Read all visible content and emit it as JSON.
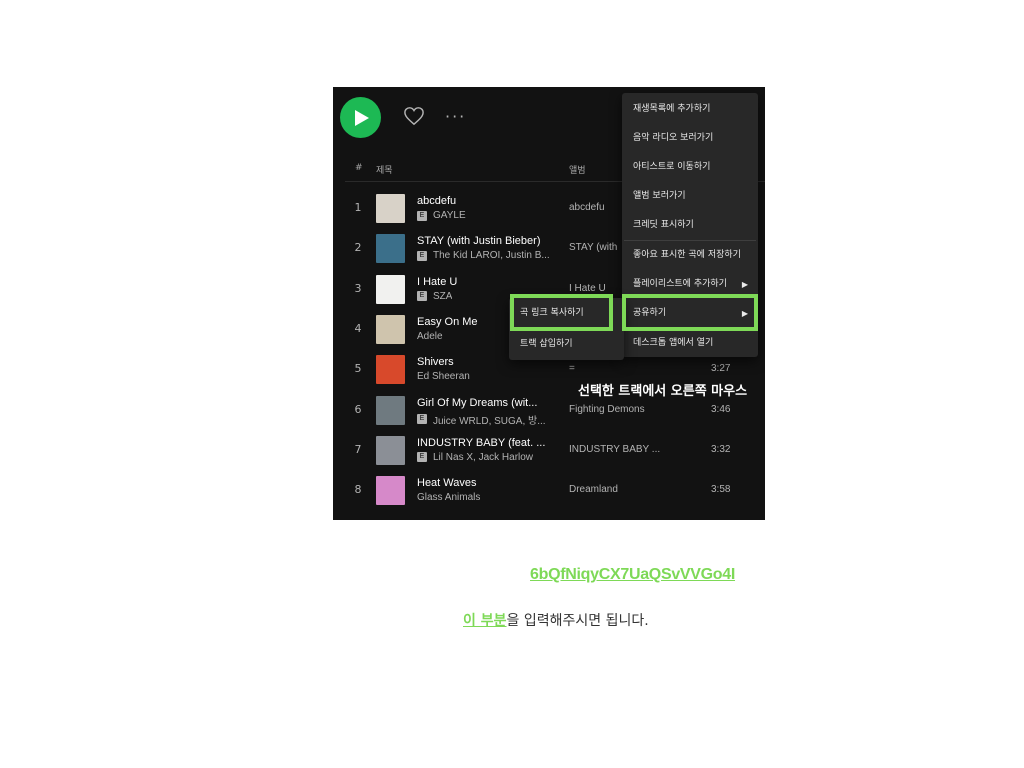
{
  "player": {
    "more_label": "···",
    "columns": {
      "index": "#",
      "title": "제목",
      "album": "앨범"
    }
  },
  "tracks": [
    {
      "num": "1",
      "title": "abcdefu",
      "explicit": true,
      "artist": "GAYLE",
      "album": "abcdefu",
      "duration": "",
      "art_color": "#d8d2c8"
    },
    {
      "num": "2",
      "title": "STAY (with Justin Bieber)",
      "explicit": true,
      "artist": "The Kid LAROI, Justin B...",
      "album": "STAY (with",
      "duration": "",
      "art_color": "#3b6f8a"
    },
    {
      "num": "3",
      "title": "I Hate U",
      "explicit": true,
      "artist": "SZA",
      "album": "I Hate U",
      "duration": "",
      "art_color": "#f1f1ef"
    },
    {
      "num": "4",
      "title": "Easy On Me",
      "explicit": false,
      "artist": "Adele",
      "album": "=",
      "duration": "",
      "art_color": "#cfc4ad"
    },
    {
      "num": "5",
      "title": "Shivers",
      "explicit": false,
      "artist": "Ed Sheeran",
      "album": "=",
      "duration": "3:27",
      "art_color": "#d8492b"
    },
    {
      "num": "6",
      "title": "Girl Of My Dreams (wit...",
      "explicit": true,
      "artist": "Juice WRLD, SUGA, 방...",
      "album": "Fighting Demons",
      "duration": "3:46",
      "art_color": "#6f7a80"
    },
    {
      "num": "7",
      "title": "INDUSTRY BABY (feat. ...",
      "explicit": true,
      "artist": "Lil Nas X, Jack Harlow",
      "album": "INDUSTRY BABY ...",
      "duration": "3:32",
      "art_color": "#8b8f96"
    },
    {
      "num": "8",
      "title": "Heat Waves",
      "explicit": false,
      "artist": "Glass Animals",
      "album": "Dreamland",
      "duration": "3:58",
      "art_color": "#d689c9"
    }
  ],
  "context_menu": {
    "items": [
      {
        "label": "재생목록에 추가하기",
        "arrow": ""
      },
      {
        "label": "음악 라디오 보러가기",
        "arrow": ""
      },
      {
        "label": "아티스트로 이동하기",
        "arrow": ""
      },
      {
        "label": "앨범 보러가기",
        "arrow": ""
      },
      {
        "label": "크레딧 표시하기",
        "arrow": ""
      },
      {
        "label": "좋아요 표시한 곡에 저장하기",
        "arrow": ""
      },
      {
        "label": "플레이리스트에 추가하기",
        "arrow": "▶"
      },
      {
        "label": "공유하기",
        "arrow": "▶"
      },
      {
        "label": "데스크톱 앱에서 열기",
        "arrow": ""
      }
    ]
  },
  "share_submenu": {
    "items": [
      {
        "label": "곡 링크 복사하기"
      },
      {
        "label": "트랙 삽입하기"
      }
    ]
  },
  "overlay_caption": "선택한 트랙에서 오른쪽 마우스",
  "highlight_color": "#7ed957",
  "track_id": "6bQfNiqyCX7UaQSvVVGo4I",
  "instruction": {
    "link_text": "이 부분",
    "rest": "을 입력해주시면 됩니다."
  }
}
